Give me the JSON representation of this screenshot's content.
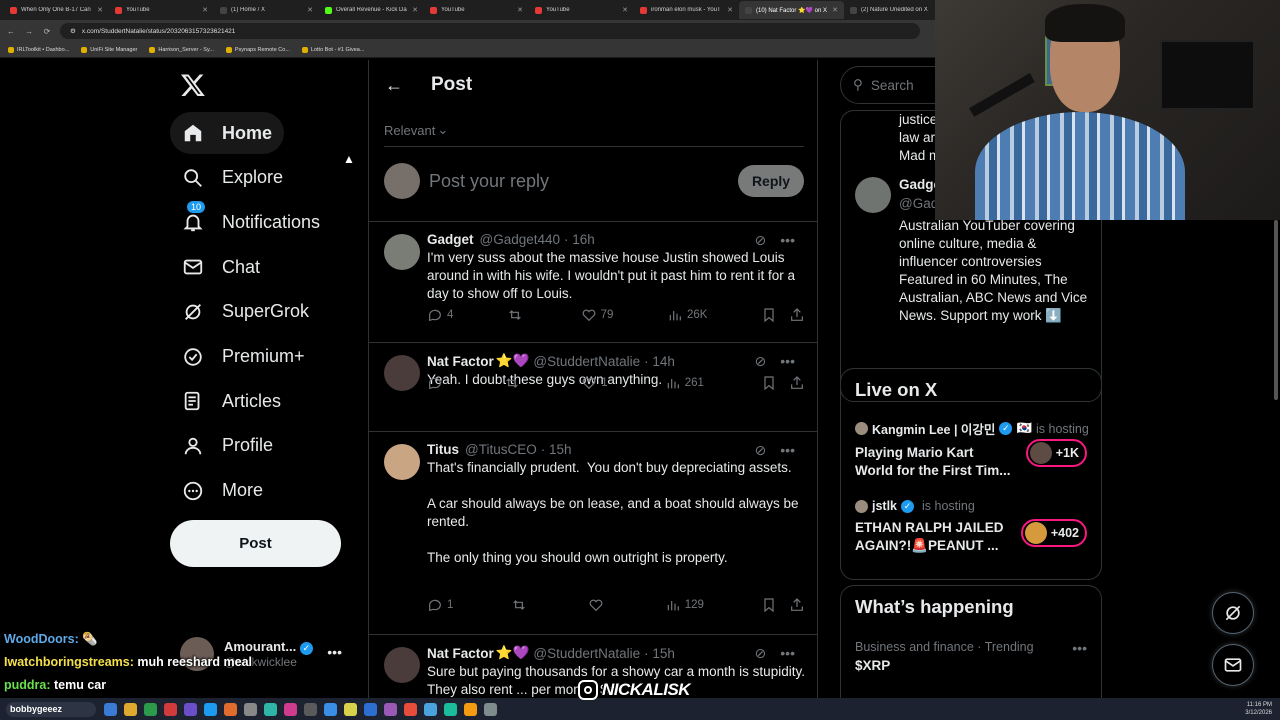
{
  "browser": {
    "tabs": [
      {
        "title": "When Only One B-17 Can",
        "color": "#e53935",
        "active": false
      },
      {
        "title": "YouTube",
        "color": "#e53935",
        "active": false
      },
      {
        "title": "(1) Home / X",
        "color": "#444444",
        "active": false
      },
      {
        "title": "Overall Revenue - Kick Da",
        "color": "#53fc18",
        "active": false
      },
      {
        "title": "YouTube",
        "color": "#e53935",
        "active": false
      },
      {
        "title": "YouTube",
        "color": "#e53935",
        "active": false
      },
      {
        "title": "ironman elon musk - YouT",
        "color": "#e53935",
        "active": false
      },
      {
        "title": "(10) Nat Factor ⭐💜 on X",
        "color": "#444444",
        "active": true
      },
      {
        "title": "(2) Nature Unedited on X",
        "color": "#444444",
        "active": false
      }
    ],
    "url": "x.com/StuddertNatalie/status/2032063157323621421",
    "bookmarks": [
      "IRLToolkit • Dashbo...",
      "UniFi Site Manager",
      "Harrison_Server - Sy...",
      "Psynaps Remote Co...",
      "Lotto Bot - #1 Givea..."
    ]
  },
  "sidebar": {
    "nav": [
      {
        "label": "Home",
        "icon": "home-icon"
      },
      {
        "label": "Explore",
        "icon": "search-icon"
      },
      {
        "label": "Notifications",
        "icon": "bell-icon",
        "badge": "10"
      },
      {
        "label": "Chat",
        "icon": "mail-icon"
      },
      {
        "label": "SuperGrok",
        "icon": "grok-icon"
      },
      {
        "label": "Premium+",
        "icon": "premium-icon"
      },
      {
        "label": "Articles",
        "icon": "articles-icon"
      },
      {
        "label": "Profile",
        "icon": "person-icon"
      },
      {
        "label": "More",
        "icon": "more-circle-icon"
      }
    ],
    "post_label": "Post",
    "account": {
      "name": "Amourant...",
      "handle": "@nickwicklee"
    }
  },
  "main": {
    "title": "Post",
    "sort_label": "Relevant",
    "reply_placeholder": "Post your reply",
    "reply_button": "Reply",
    "tweets": [
      {
        "name": "Gadget",
        "emoji": "",
        "handle": "@Gadget440",
        "time": "· 16h",
        "text": "I'm very suss about the massive house Justin showed Louis around in with his wife. I wouldn't put it past him to rent it for a day to show off to Louis.",
        "replies": "4",
        "reposts": "",
        "likes": "79",
        "views": "26K",
        "avatar_color": "#7a7d76"
      },
      {
        "name": "Nat Factor",
        "emoji": "⭐💜",
        "handle": "@StuddertNatalie",
        "time": "· 14h",
        "text": "Yeah. I doubt these guys own anything.",
        "replies": "",
        "reposts": "",
        "likes": "1",
        "views": "261",
        "avatar_color": "#4a3c3a"
      },
      {
        "name": "Titus",
        "emoji": "",
        "handle": "@TitusCEO",
        "time": "· 15h",
        "text": "That's financially prudent.  You don't buy depreciating assets.\n\nA car should always be on lease, and a boat should always be rented.\n\nThe only thing you should own outright is property.",
        "replies": "1",
        "reposts": "",
        "likes": "",
        "views": "129",
        "avatar_color": "#c9a584"
      },
      {
        "name": "Nat Factor",
        "emoji": "⭐💜",
        "handle": "@StuddertNatalie",
        "time": "· 15h",
        "text": "Sure but paying thousands for a showy car a month is stupidity. They also rent ... per month. So..",
        "replies": "",
        "reposts": "",
        "likes": "",
        "views": "",
        "avatar_color": "#4a3c3a"
      }
    ]
  },
  "right": {
    "search_placeholder": "Search",
    "profile_card": {
      "top_lines": [
        "justice",
        "law ar",
        "Mad m"
      ],
      "name": "Gadge",
      "handle": "@Gad",
      "bio": "Australian YouTuber covering online culture, media & influencer controversies Featured in 60 Minutes, The Australian, ABC News and Vice News. Support my work ⬇️"
    },
    "live": {
      "title": "Live on X",
      "items": [
        {
          "host": "Kangmin Lee | 이강민",
          "hosting": "is hosting",
          "flag": "🇰🇷",
          "title": "Playing Mario Kart World for the First Tim...",
          "count": "+1K"
        },
        {
          "host": "jstlk",
          "hosting": "is hosting",
          "flag": "",
          "title": "ETHAN RALPH JAILED AGAIN?!🚨PEANUT ...",
          "count": "+402"
        }
      ]
    },
    "happening": {
      "title": "What’s happening",
      "trend_category": "Business and finance · Trending",
      "trend_name": "$XRP"
    }
  },
  "chat": [
    {
      "user": "WoodDoors:",
      "msg": "🌯",
      "color": "#5fa9e8"
    },
    {
      "user": "Iwatchboringstreams:",
      "msg": "muh reeshard meal",
      "color": "#f5e04b"
    },
    {
      "user": "puddra:",
      "msg": "temu car",
      "color": "#6be04f"
    }
  ],
  "taskbar": {
    "search_text": "bobbygeeez",
    "time": "11:16 PM",
    "date": "3/12/2026"
  },
  "brand": "NICKALISK"
}
